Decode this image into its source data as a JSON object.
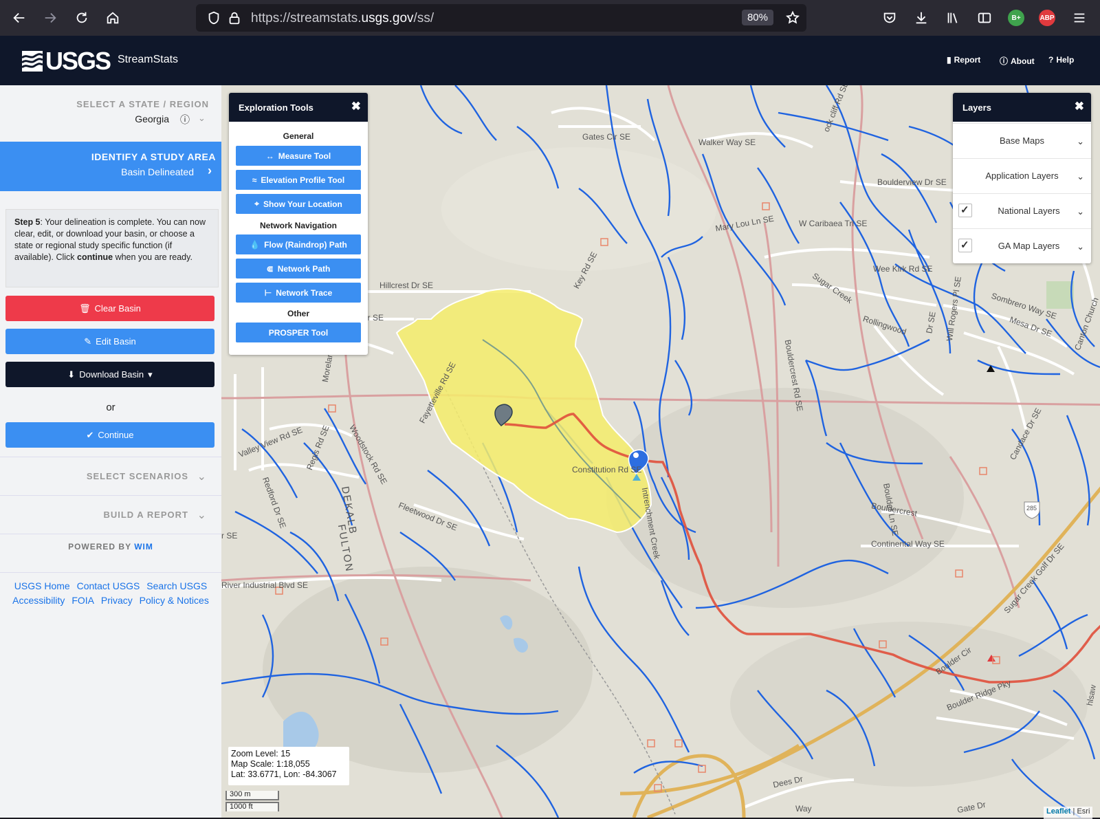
{
  "browser": {
    "url_prefix": "https://streamstats.",
    "url_domain": "usgs.gov",
    "url_path": "/ss/",
    "zoom": "80%",
    "ext_badge_1": "B+",
    "ext_badge_2": "ABP"
  },
  "header": {
    "logo_text": "USGS",
    "app_name": "StreamStats",
    "nav": [
      {
        "label": "Report",
        "icon": "report-icon"
      },
      {
        "label": "About",
        "icon": "info-icon"
      },
      {
        "label": "Help",
        "icon": "help-icon"
      }
    ]
  },
  "sidebar": {
    "state_title": "SELECT A STATE / REGION",
    "state_value": "Georgia",
    "study_title": "IDENTIFY A STUDY AREA",
    "study_sub": "Basin Delineated",
    "step_label": "Step 5",
    "step_text_1": ": Your delineation is complete. You can now clear, edit, or download your basin, or choose a state or regional study specific function (if available). Click ",
    "step_continue": "continue",
    "step_text_2": " when you are ready.",
    "buttons": {
      "clear": "Clear Basin",
      "edit": "Edit Basin",
      "download": "Download Basin",
      "or": "or",
      "continue": "Continue"
    },
    "scenarios": "SELECT SCENARIOS",
    "report": "BUILD A REPORT",
    "powered_by": "POWERED BY",
    "powered_org": "WIM",
    "footer_links": [
      "USGS Home",
      "Contact USGS",
      "Search USGS",
      "Accessibility",
      "FOIA",
      "Privacy",
      "Policy & Notices"
    ]
  },
  "exploration": {
    "title": "Exploration Tools",
    "general": "General",
    "measure": "Measure Tool",
    "elevation": "Elevation Profile Tool",
    "location": "Show Your Location",
    "network_nav": "Network Navigation",
    "flow": "Flow (Raindrop) Path",
    "network_path": "Network Path",
    "network_trace": "Network Trace",
    "other": "Other",
    "prosper": "PROSPER Tool"
  },
  "layers": {
    "title": "Layers",
    "items": [
      {
        "label": "Base Maps",
        "checked": false
      },
      {
        "label": "Application Layers",
        "checked": false
      },
      {
        "label": "National Layers",
        "checked": true
      },
      {
        "label": "GA Map Layers",
        "checked": true
      }
    ]
  },
  "map_info": {
    "zoom": "Zoom Level: 15",
    "scale": "Map Scale: 1:18,055",
    "latlon": "Lat: 33.6771, Lon: -84.3067",
    "scale_m": "300 m",
    "scale_ft": "1000 ft",
    "attrib_leaflet": "Leaflet",
    "attrib_esri": "| Esri"
  },
  "map_labels": [
    "Gates Cir SE",
    "Walker Way SE",
    "ock cliff Rd SE",
    "Boulderview Dr SE",
    "Mary Lou Ln SE",
    "W Caribaea Trl SE",
    "Key Rd SE",
    "Hillcrest Dr SE",
    "Dr SE",
    "Wee Kirk Rd SE",
    "Sugar Creek",
    "Sombrero Way SE",
    "Mesa Dr SE",
    "Rollingwood",
    "Dr SE",
    "Will Rogers Pl SE",
    "Bouldercrest Rd SE",
    "Fayetteville Rd SE",
    "Moreland",
    "Valley View Rd SE",
    "Regis Rd SE",
    "Woodstock Rd SE",
    "Constitution Rd SE",
    "Intrenchment Creek",
    "Candace Dr SE",
    "Boulder Ln SE",
    "Bouldercrest",
    "Continental Way SE",
    "DEKALB",
    "FULTON",
    "Fleetwood Dr SE",
    "Redford Dr SE",
    "r SE",
    "River Industrial Blvd SE",
    "Sugar Creek Golf Dr SE",
    "Boulder Cir",
    "Boulder Ridge Pky",
    "Dees Dr",
    "Gate Dr",
    "Way",
    "285",
    "Canton Church",
    "hlsaw"
  ]
}
